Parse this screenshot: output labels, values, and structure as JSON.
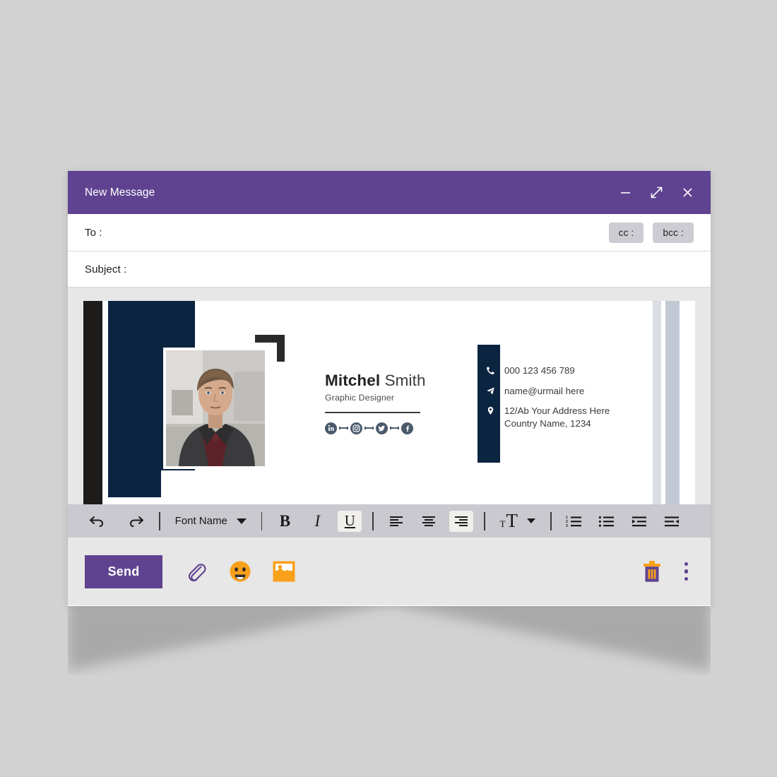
{
  "theme": {
    "purple": "#5f4391",
    "navy": "#0b2440",
    "orange": "#f9a01b",
    "slate": "#4b5a6b",
    "page_bg": "#d2d2d2"
  },
  "window": {
    "title": "New Message",
    "controls": [
      {
        "name": "minimize",
        "label": "Minimize"
      },
      {
        "name": "expand",
        "label": "Expand"
      },
      {
        "name": "close",
        "label": "Close"
      }
    ]
  },
  "fields": {
    "to_label": "To :",
    "to_value": "",
    "to_placeholder": "",
    "cc_label": "cc :",
    "bcc_label": "bcc :",
    "subject_label": "Subject :",
    "subject_value": "",
    "subject_placeholder": ""
  },
  "signature": {
    "first_name": "Mitchel",
    "last_name": "Smith",
    "job_title": "Graphic Designer",
    "socials": [
      {
        "name": "linkedin-icon",
        "label": "LinkedIn"
      },
      {
        "name": "instagram-icon",
        "label": "Instagram"
      },
      {
        "name": "twitter-icon",
        "label": "Twitter"
      },
      {
        "name": "facebook-icon",
        "label": "Facebook"
      }
    ],
    "contacts": [
      {
        "icon": "phone-icon",
        "text": "000 123 456 789"
      },
      {
        "icon": "send-mail-icon",
        "text": "name@urmail here"
      },
      {
        "icon": "location-pin-icon",
        "text": "12/Ab Your Address Here\nCountry Name, 1234"
      }
    ]
  },
  "toolbar": {
    "undo_label": "Undo",
    "redo_label": "Redo",
    "font_name": "Font Name",
    "bold_label": "B",
    "italic_label": "I",
    "underline_label": "U",
    "align_left_label": "Align left",
    "align_center_label": "Align center",
    "align_right_label": "Align right",
    "font_size_small": "T",
    "font_size_large": "T",
    "numbered_list_label": "Numbered list",
    "bulleted_list_label": "Bulleted list",
    "indent_increase_label": "Increase indent",
    "indent_decrease_label": "Decrease indent",
    "active_align": "right",
    "active_style": "underline"
  },
  "actions": {
    "send_label": "Send",
    "attach_label": "Attach file",
    "emoji_label": "Insert emoji",
    "image_label": "Insert image",
    "delete_label": "Discard draft",
    "more_label": "More options"
  }
}
